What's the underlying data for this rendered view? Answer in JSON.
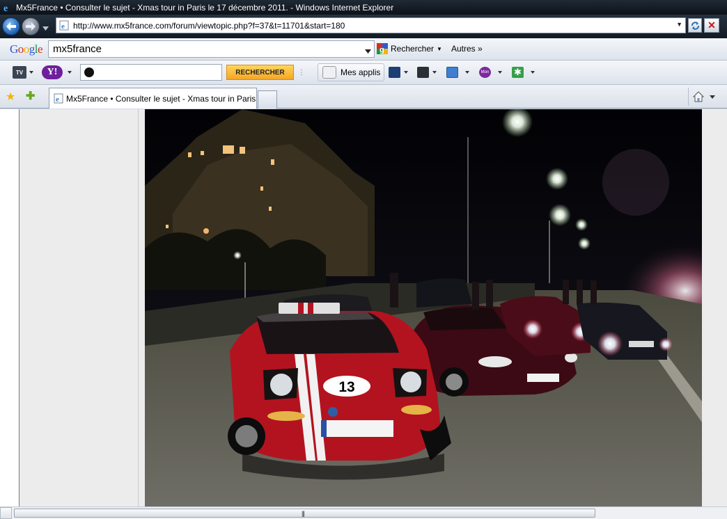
{
  "window": {
    "title": "Mx5France • Consulter le sujet - Xmas tour in Paris le 17 décembre 2011. - Windows Internet Explorer"
  },
  "address_bar": {
    "url": "http://www.mx5france.com/forum/viewtopic.php?f=37&t=11701&start=180"
  },
  "google_toolbar": {
    "logo": "Google",
    "search_value": "mx5france",
    "search_button": "Rechercher",
    "more_label": "Autres »"
  },
  "yahoo_toolbar": {
    "tv_label": "TV",
    "logo": "Y!",
    "search_value": "",
    "search_button": "RECHERCHER",
    "apps_label": "Mes applis",
    "mail_icon_label": "Mon"
  },
  "tabs": [
    {
      "label": "Mx5France • Consulter le sujet - Xmas tour in Paris..."
    }
  ],
  "photo": {
    "race_number": "13"
  }
}
